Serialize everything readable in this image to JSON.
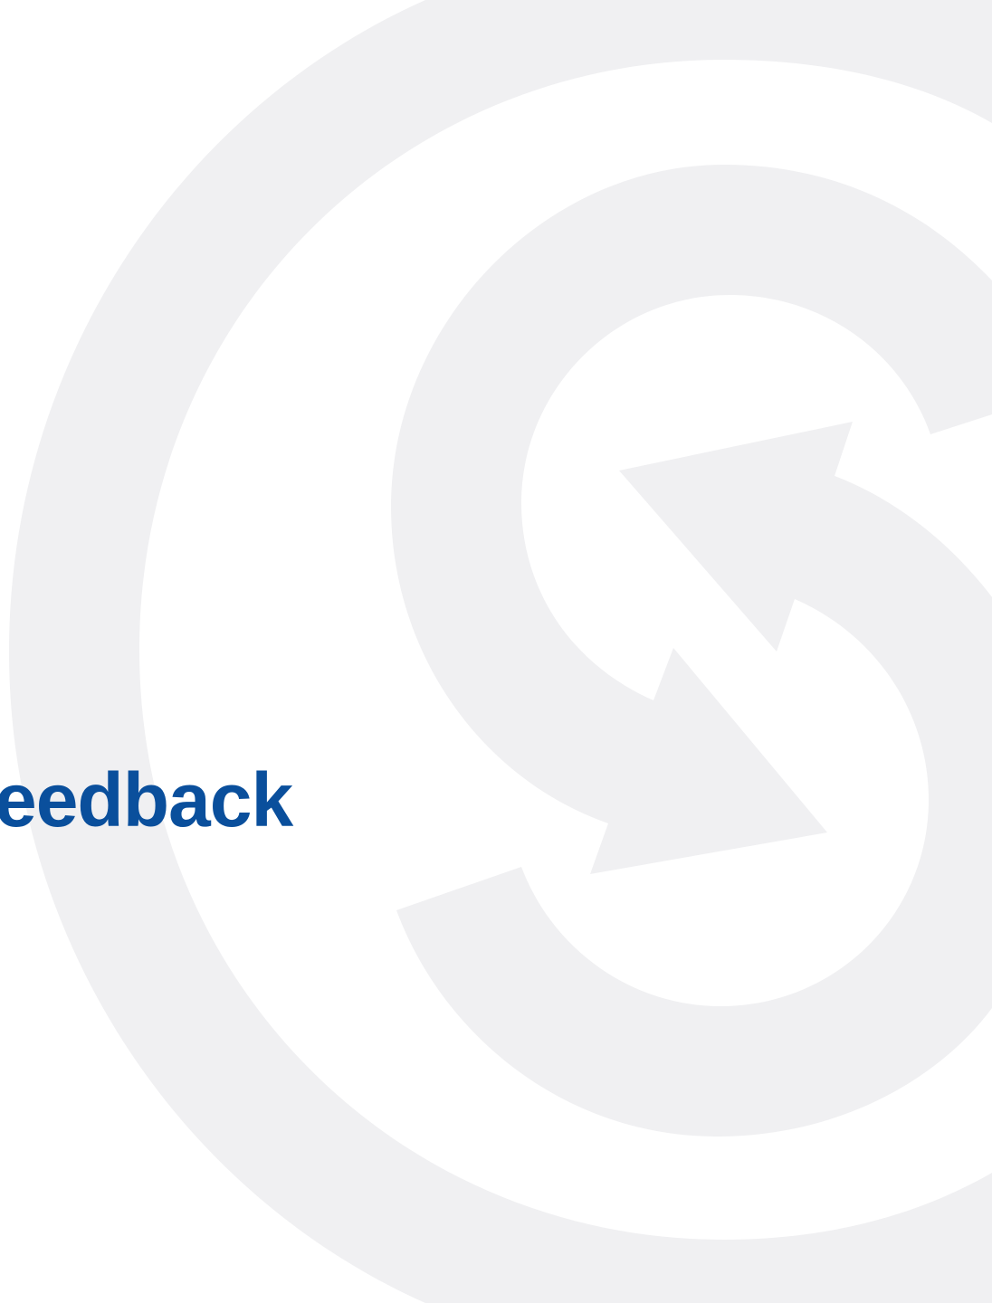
{
  "page": {
    "background_color": "#ffffff"
  },
  "watermark": {
    "icon": "circular-arrows-logo-icon",
    "color": "#f0f0f2"
  },
  "heading": {
    "text": "eedback",
    "color": "#0a4f9c"
  }
}
